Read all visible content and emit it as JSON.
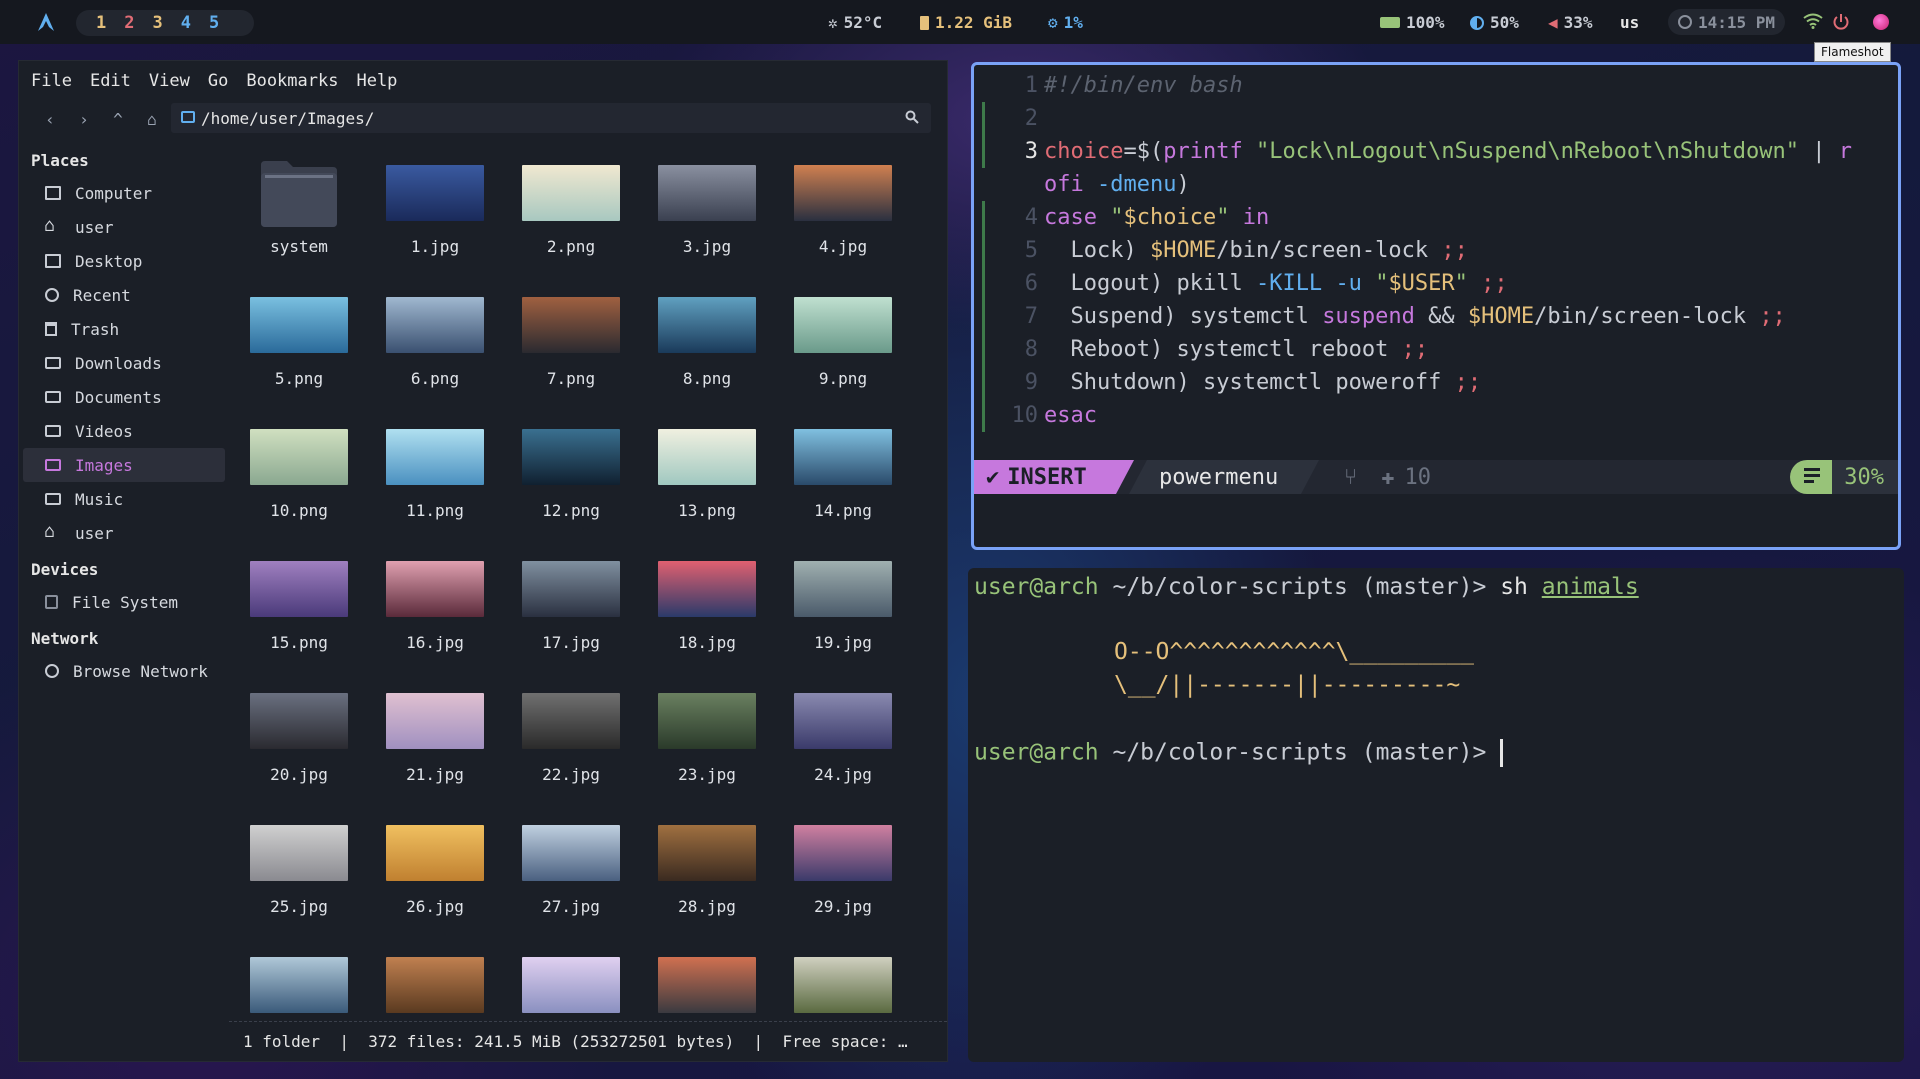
{
  "topbar": {
    "workspaces": [
      "1",
      "2",
      "3",
      "4",
      "5"
    ],
    "active_workspace": "2",
    "temperature": "52°C",
    "memory": "1.22 GiB",
    "cpu": "1%",
    "battery": "100%",
    "brightness": "50%",
    "volume": "33%",
    "keyboard_layout": "us",
    "clock": "14:15 PM",
    "tooltip": "Flameshot"
  },
  "file_manager": {
    "menu": [
      "File",
      "Edit",
      "View",
      "Go",
      "Bookmarks",
      "Help"
    ],
    "path": "/home/user/Images/",
    "sidebar": {
      "places_heading": "Places",
      "places": [
        "Computer",
        "user",
        "Desktop",
        "Recent",
        "Trash",
        "Downloads",
        "Documents",
        "Videos",
        "Images",
        "Music",
        "user"
      ],
      "selected": "Images",
      "devices_heading": "Devices",
      "devices": [
        "File System"
      ],
      "network_heading": "Network",
      "network": [
        "Browse Network"
      ]
    },
    "files": [
      "system",
      "1.jpg",
      "2.png",
      "3.jpg",
      "4.jpg",
      "5.png",
      "6.png",
      "7.png",
      "8.png",
      "9.png",
      "10.png",
      "11.png",
      "12.png",
      "13.png",
      "14.png",
      "15.png",
      "16.jpg",
      "17.jpg",
      "18.jpg",
      "19.jpg",
      "20.jpg",
      "21.jpg",
      "22.jpg",
      "23.jpg",
      "24.jpg",
      "25.jpg",
      "26.jpg",
      "27.jpg",
      "28.jpg",
      "29.jpg",
      "",
      "",
      "",
      "",
      ""
    ],
    "status": "1 folder  |  372 files: 241.5 MiB (253272501 bytes)  |  Free space: …"
  },
  "editor": {
    "lines": [
      {
        "n": "1",
        "text": "#!/bin/env bash"
      },
      {
        "n": "2",
        "text": ""
      },
      {
        "n": "3",
        "text": "choice=$(printf \"Lock\\nLogout\\nSuspend\\nReboot\\nShutdown\" | r"
      },
      {
        "n": "",
        "text": "ofi -dmenu)"
      },
      {
        "n": "4",
        "text": "case \"$choice\" in"
      },
      {
        "n": "5",
        "text": "  Lock) $HOME/bin/screen-lock ;;"
      },
      {
        "n": "6",
        "text": "  Logout) pkill -KILL -u \"$USER\" ;;"
      },
      {
        "n": "7",
        "text": "  Suspend) systemctl suspend && $HOME/bin/screen-lock ;;"
      },
      {
        "n": "8",
        "text": "  Reboot) systemctl reboot ;;"
      },
      {
        "n": "9",
        "text": "  Shutdown) systemctl poweroff ;;"
      },
      {
        "n": "10",
        "text": "esac"
      }
    ],
    "mode": "INSERT",
    "filename": "powermenu",
    "git_added": "10",
    "percent": "30%"
  },
  "terminal": {
    "prompt1_user": "user@arch",
    "prompt1_path": " ~/b/color-scripts (master)> ",
    "cmd": "sh ",
    "cmd_arg": "animals",
    "ascii1": "O--O^^^^^^^^^^^^\\_________",
    "ascii2": "\\__/||-------||---------~",
    "prompt2_user": "user@arch",
    "prompt2_path": " ~/b/color-scripts (master)> "
  }
}
